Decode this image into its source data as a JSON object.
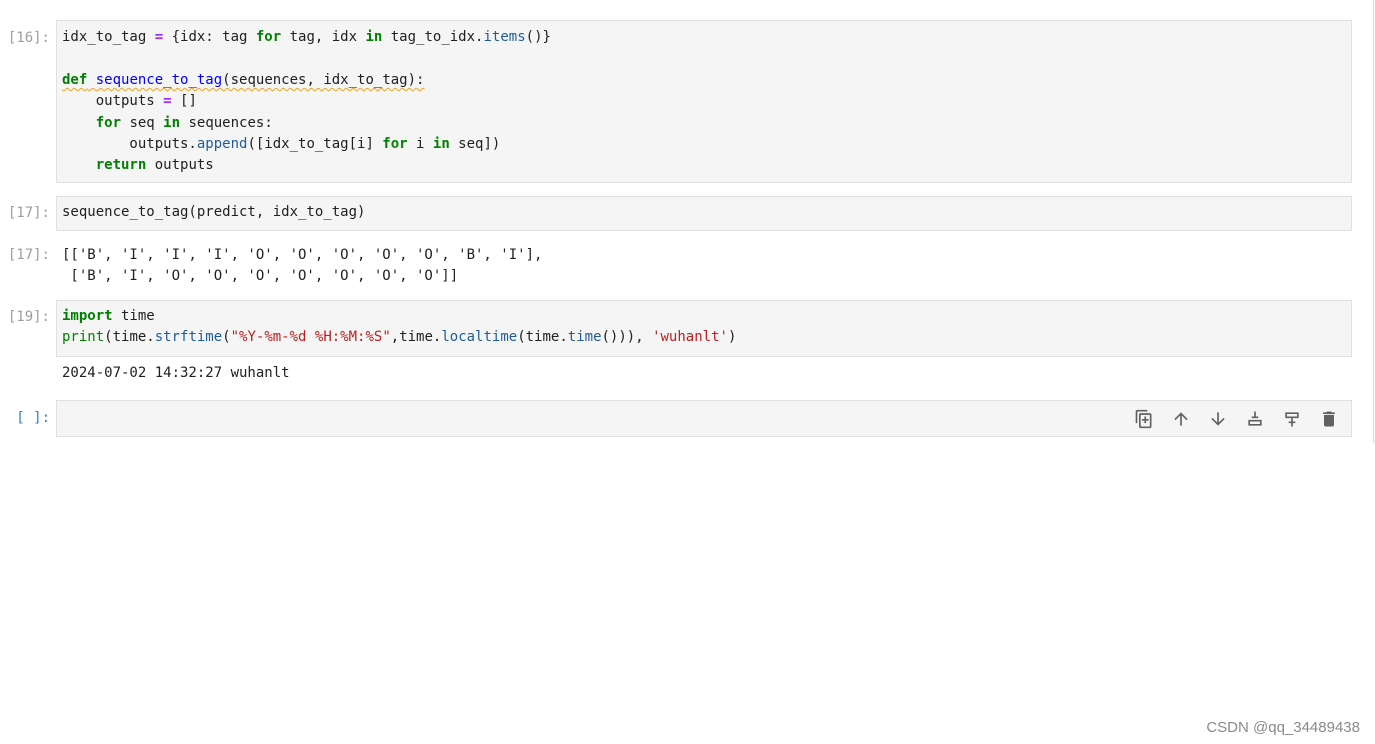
{
  "cells": [
    {
      "prompt": "[16]:",
      "code": [
        "idx_to_tag = {idx: tag for tag, idx in tag_to_idx.items()}",
        "",
        "def sequence_to_tag(sequences, idx_to_tag):",
        "    outputs = []",
        "    for seq in sequences:",
        "        outputs.append([idx_to_tag[i] for i in seq])",
        "    return outputs"
      ]
    },
    {
      "prompt": "[17]:",
      "code": [
        "sequence_to_tag(predict, idx_to_tag)"
      ],
      "output_prompt": "[17]:",
      "output": [
        "[['B', 'I', 'I', 'I', 'O', 'O', 'O', 'O', 'O', 'B', 'I'],",
        " ['B', 'I', 'O', 'O', 'O', 'O', 'O', 'O', 'O']]"
      ]
    },
    {
      "prompt": "[19]:",
      "code": [
        "import time",
        "print(time.strftime(\"%Y-%m-%d %H:%M:%S\",time.localtime(time.time())), 'wuhanlt')"
      ],
      "output": [
        "2024-07-02 14:32:27 wuhanlt"
      ]
    },
    {
      "prompt": "[ ]:",
      "code": [
        ""
      ]
    }
  ],
  "toolbar": {
    "buttons": [
      "duplicate-icon",
      "move-up-icon",
      "move-down-icon",
      "insert-above-icon",
      "insert-below-icon",
      "delete-icon"
    ]
  },
  "watermark": "CSDN @qq_34489438",
  "colors": {
    "keyword": "#008000",
    "operator": "#aa22ff",
    "function": "#0000ff",
    "string": "#ba2121",
    "active_prompt": "#307fc1"
  }
}
